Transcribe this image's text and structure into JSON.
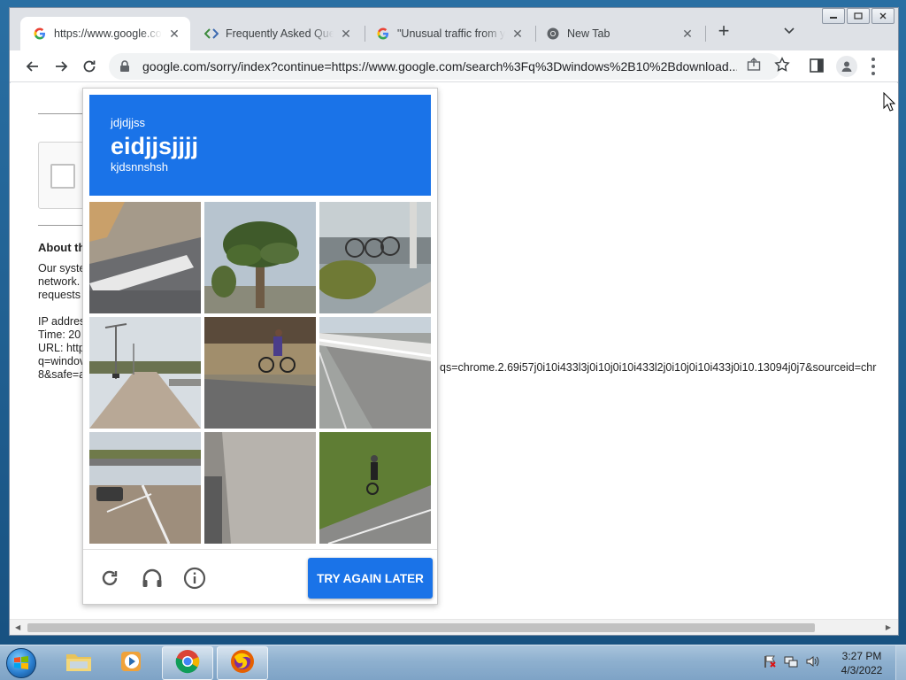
{
  "browser": {
    "tabs": [
      {
        "title": "https://www.google.com",
        "active": true,
        "favicon": "google-g-icon"
      },
      {
        "title": "Frequently Asked Questions",
        "active": false,
        "favicon": "code-brackets-icon"
      },
      {
        "title": "\"Unusual traffic from your",
        "active": false,
        "favicon": "google-g-icon"
      },
      {
        "title": "New Tab",
        "active": false,
        "favicon": "chrome-icon"
      }
    ],
    "tab_close": "✕",
    "new_tab": "+",
    "address": "google.com/sorry/index?continue=https://www.google.com/search%3Fq%3Dwindows%2B10%2Bdownload..."
  },
  "page": {
    "about_heading": "About th",
    "para_lines": [
      "Our syste",
      "network.",
      "requests"
    ],
    "info_lines": [
      "IP addres",
      "Time: 20",
      "URL: http",
      "q=windov",
      "8&safe=a"
    ],
    "url_continuation": "qs=chrome.2.69i57j0i10i433l3j0i10j0i10i433l2j0i10j0i10i433j0i10.13094j0j7&sourceid=chr"
  },
  "captcha": {
    "header_small": "jdjdjjss",
    "header_big": "eidjjsjjjj",
    "header_sub": "kjdsnnshsh",
    "button": "TRY AGAIN LATER",
    "tiles": [
      "crosswalk-road-tile",
      "palm-tree-tile",
      "bicycles-rack-tile",
      "highway-streetlights-tile",
      "cyclist-road-tile",
      "bridge-railing-tile",
      "overpass-car-tile",
      "road-pavement-tile",
      "cyclist-grass-tile"
    ]
  },
  "taskbar": {
    "time": "3:27 PM",
    "date": "4/3/2022"
  },
  "colors": {
    "accent": "#1a73e8",
    "taskbar": "#8eb0cf",
    "tabstrip": "#dee1e6"
  }
}
